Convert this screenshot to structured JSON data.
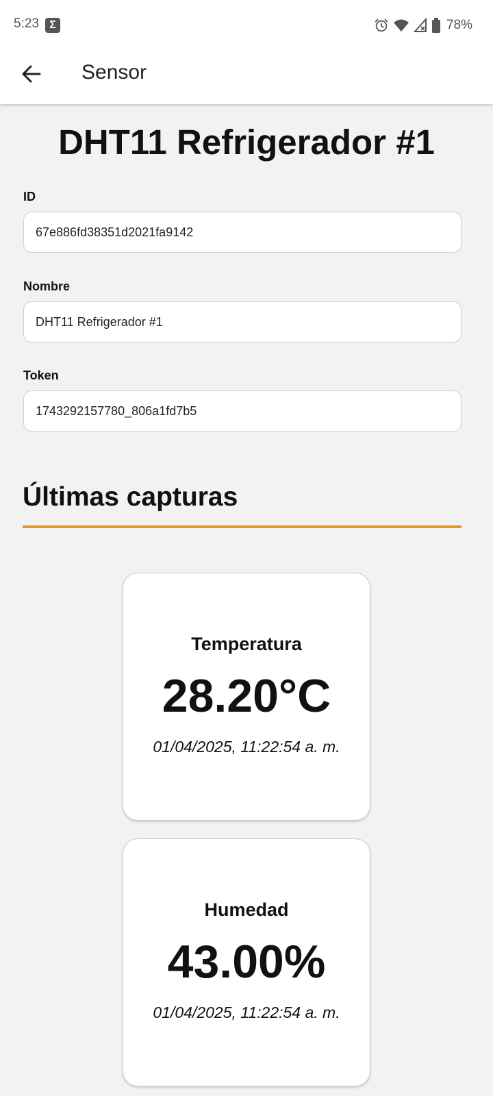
{
  "status_bar": {
    "time": "5:23",
    "battery_percent": "78%",
    "icons": [
      "sigma-icon",
      "alarm-icon",
      "wifi-icon",
      "no-signal-icon",
      "battery-icon"
    ]
  },
  "app_bar": {
    "back_icon": "arrow-left-icon",
    "title": "Sensor"
  },
  "sensor": {
    "title": "DHT11 Refrigerador #1",
    "fields": {
      "id": {
        "label": "ID",
        "value": "67e886fd38351d2021fa9142"
      },
      "nombre": {
        "label": "Nombre",
        "value": "DHT11 Refrigerador #1"
      },
      "token": {
        "label": "Token",
        "value": "1743292157780_806a1fd7b5"
      }
    }
  },
  "captures": {
    "title": "Últimas capturas",
    "accent_color": "#f0961e",
    "items": [
      {
        "label": "Temperatura",
        "value": "28.20°C",
        "timestamp": "01/04/2025, 11:22:54 a. m."
      },
      {
        "label": "Humedad",
        "value": "43.00%",
        "timestamp": "01/04/2025, 11:22:54 a. m."
      }
    ]
  }
}
